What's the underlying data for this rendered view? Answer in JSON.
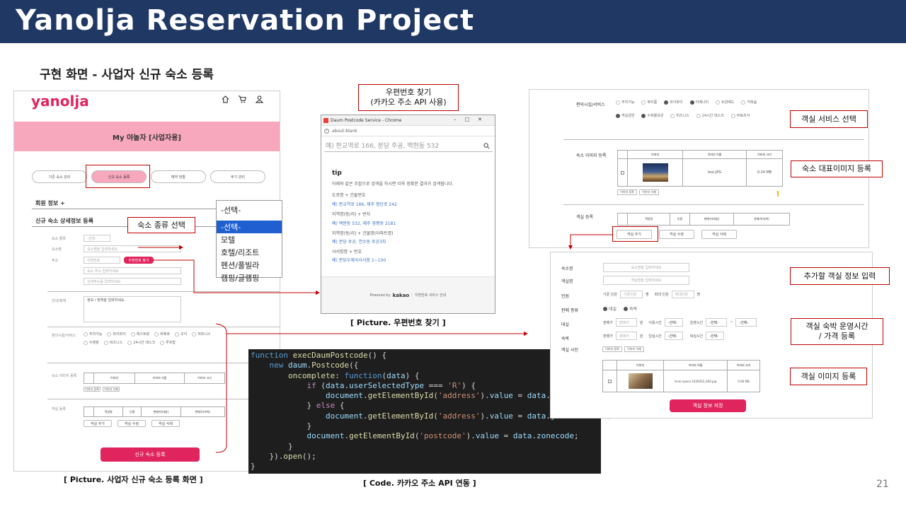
{
  "header_title": "Yanolja Reservation Project",
  "subtitle": "구현 화면 - 사업자 신규 숙소 등록",
  "page_number": "21",
  "left": {
    "logo": "yanolja",
    "nav_icons": [
      "home-icon",
      "cart-icon",
      "user-icon"
    ],
    "banner": "My 야놀자 [사업자용]",
    "tabs": [
      "기존 숙소 관리",
      "신규 숙소 등록",
      "예약 현황",
      "후기 관리"
    ],
    "member_info": "회원 정보 +",
    "detail_title": "신규 숙소 상세정보 등록",
    "labels": [
      "숙소 종류",
      "숙소명",
      "주소",
      "안내/정책",
      "편의시설/서비스",
      "숙소 이미지 등록",
      "객실 등록"
    ],
    "select_value": "-선택-",
    "name_placeholder": "숙소명을 입력하세요",
    "postcode_placeholder": "우편번호",
    "postcode_btn": "우편번호 찾기",
    "addr_placeholder": "숙소 주소 입력하세요",
    "addr_detail_placeholder": "상세주소를 입력하세요",
    "policy_text": "정보 / 정책을 입력하세요.",
    "amenities": [
      "주차가능",
      "와이파이",
      "레스토랑",
      "바베큐",
      "조식",
      "피트니스",
      "수영장",
      "비즈니스",
      "24시간 데스크",
      "루프탑"
    ],
    "img_table_headers": [
      "",
      "이미지",
      "이미지 이름",
      "이미지 크기"
    ],
    "img_buttons": [
      "이미지 등록",
      "이미지 삭제"
    ],
    "room_table_headers": [
      "객실명",
      "인원",
      "판매가(대실)",
      "판매가(숙박)"
    ],
    "room_buttons": [
      "객실 추가",
      "객실 수정",
      "객실 삭제"
    ],
    "submit": "신규 숙소 등록",
    "caption": "[ Picture. 사업자 신규 숙소 등록 화면 ]"
  },
  "dropdown": {
    "current": "-선택-",
    "options": [
      "-선택-",
      "모텔",
      "호텔/리조트",
      "펜션/풀빌라",
      "캠핑/글램핑"
    ]
  },
  "callouts": {
    "type_select": "숙소 종류 선택",
    "postcode": "우편번호 찾기\n(카카오 주소 API 사용)",
    "room_service": "객실 서비스 선택",
    "main_image": "숙소 대표이미지 등록",
    "room_info": "추가할 객실 정보 입력",
    "room_time": "객실 숙박 운영시간\n/ 가격 등록",
    "room_image": "객실 이미지 등록"
  },
  "popup": {
    "window_title": "Daum Postcode Service - Chrome",
    "url": "about:blank",
    "search_placeholder": "예) 판교역로 166, 분당 주공, 백현동 532",
    "tip_title": "tip",
    "tip_desc": "아래와 같은 조합으로 검색을 하시면 더욱 정확한 결과가 검색됩니다.",
    "groups": [
      {
        "label": "도로명 + 건물번호",
        "example": "예) 판교역로 166,  제주 첨단로 242"
      },
      {
        "label": "지역명(동/리) + 번지",
        "example": "예) 백현동 532,  제주 영평동 2181"
      },
      {
        "label": "지역명(동/리) + 건물명(아파트명)",
        "example": "예) 분당 주공,  연수동 주공3차"
      },
      {
        "label": "사서함명 + 번호",
        "example": "예) 분당우체국사서함 1~100"
      }
    ],
    "footer_powered": "Powered by",
    "footer_brand": "kakao",
    "footer_link": "우편번호 서비스 안내",
    "caption": "[ Picture. 우편번호 찾기 ]"
  },
  "code": {
    "caption": "[ Code. 카카오 주소 API 연동 ]"
  },
  "right": {
    "amenity_label": "편의시설/서비스",
    "amenities": [
      {
        "t": "주차가능",
        "on": false
      },
      {
        "t": "파티룸",
        "on": false
      },
      {
        "t": "와이파이",
        "on": true
      },
      {
        "t": "어메니티",
        "on": true
      },
      {
        "t": "트윈베드",
        "on": false
      },
      {
        "t": "커피숍",
        "on": false
      },
      {
        "t": "객실금연",
        "on": true
      },
      {
        "t": "수화물보관",
        "on": true
      },
      {
        "t": "비즈니스",
        "on": false
      },
      {
        "t": "24시간 데스크",
        "on": false
      },
      {
        "t": "무료조식",
        "on": false
      }
    ],
    "img_label": "숙소 이미지 등록",
    "img_headers": [
      "",
      "이미지",
      "이미지 이름",
      "이미지 크기"
    ],
    "img_name": "test.JPG",
    "img_size": "0.24 MB",
    "img_buttons": [
      "이미지 등록",
      "이미지 삭제"
    ],
    "room_label": "객실 등록",
    "room_headers": [
      "객실명",
      "인원",
      "판매가(대실)",
      "판매가(숙박)"
    ],
    "room_buttons": [
      "객실 추가",
      "객실 수정",
      "객실 삭제"
    ],
    "form": {
      "name_label": "숙소명",
      "name_ph": "숙소명을 입력하세요",
      "room_label": "객실명",
      "room_ph": "객실명을 입력하세요",
      "people_label": "인원",
      "std": "기준 인원",
      "std_ph": "기준인원",
      "unit": "명",
      "max": "최대 인원",
      "max_ph": "최대인원",
      "sale_label": "판매 종류",
      "sale_opts": [
        "대실",
        "숙박"
      ],
      "day_label": "대실",
      "price": "판매가",
      "price_ph": "판매가",
      "won": "원",
      "use_time": "이용시간",
      "sel": "-선택-",
      "op_time": "운영시간",
      "tilde": "~",
      "stay_label": "숙박",
      "checkin": "입실시간",
      "checkout": "퇴실시간",
      "roomimg_label": "객실 사진"
    },
    "room_img_headers": [
      "",
      "이미지",
      "이미지 이름",
      "이미지 크기"
    ],
    "room_img_name": "inner-space-1026452_640.jpg",
    "room_img_size": "0.06 MB",
    "save": "객실 정보 저장"
  }
}
